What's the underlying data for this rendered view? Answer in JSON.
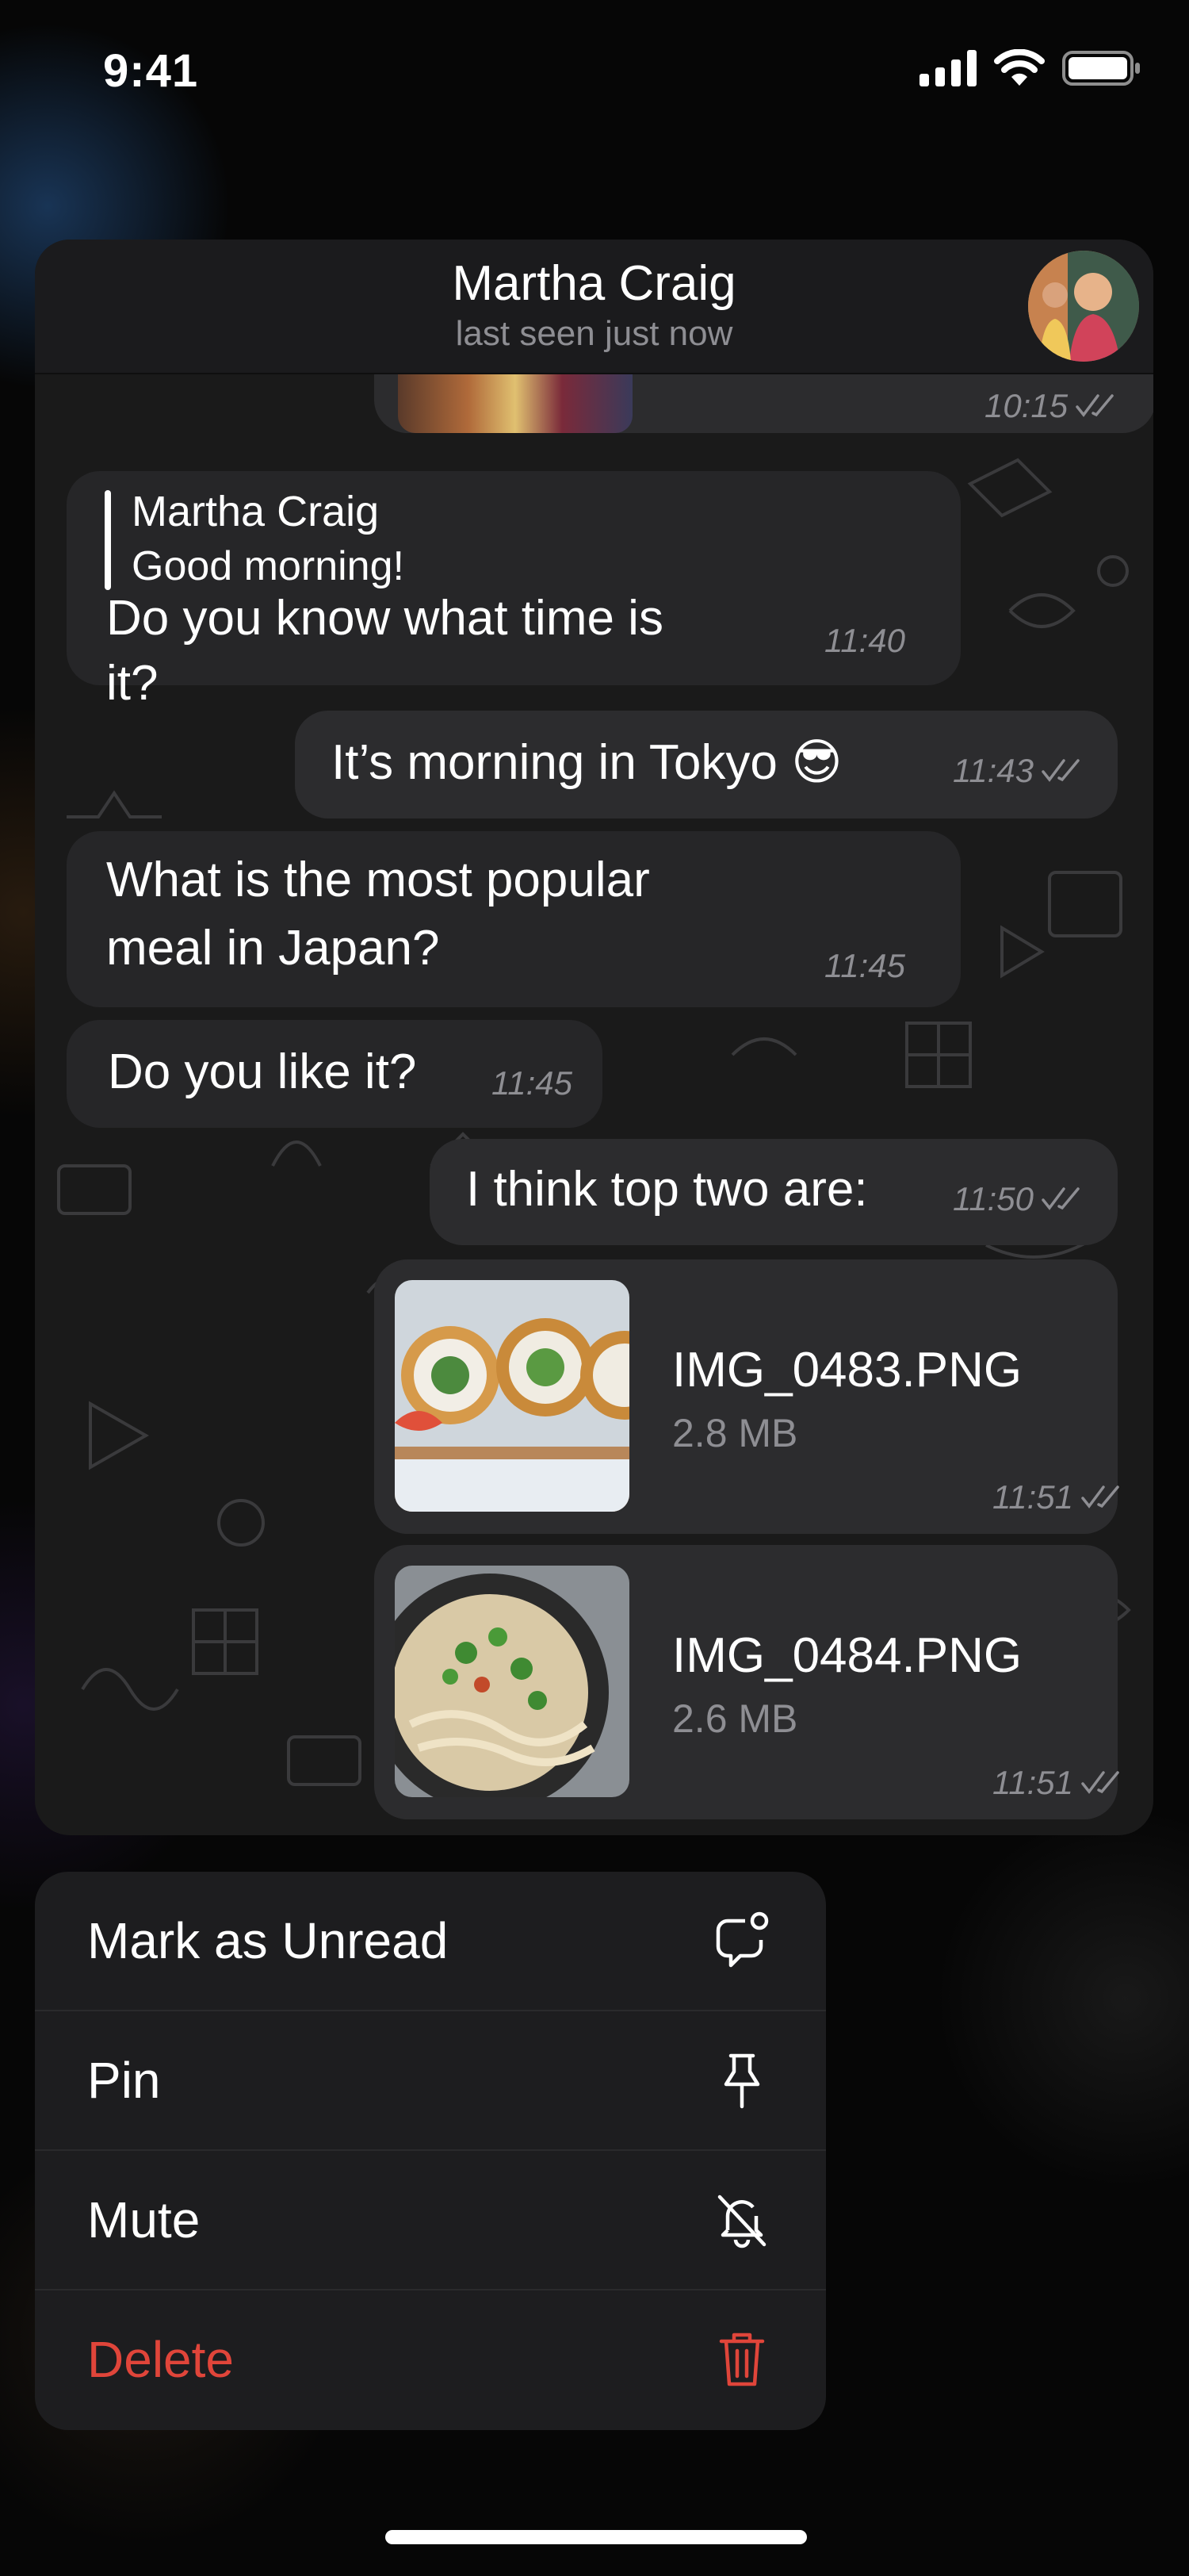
{
  "status_bar": {
    "time": "9:41"
  },
  "chat": {
    "contact_name": "Martha Craig",
    "subtitle": "last seen just now",
    "messages": [
      {
        "id": "m0",
        "direction": "out",
        "type": "image-partial",
        "time": "10:15"
      },
      {
        "id": "m1",
        "direction": "in",
        "reply_to_name": "Martha Craig",
        "reply_to_text": "Good morning!",
        "text_line1": "Do you know what time is",
        "text_line2": "it?",
        "time": "11:40"
      },
      {
        "id": "m2",
        "direction": "out",
        "text": "It’s morning in Tokyo 😎",
        "time": "11:43"
      },
      {
        "id": "m3",
        "direction": "in",
        "text_line1": "What is the most popular",
        "text_line2": "meal in Japan?",
        "time": "11:45"
      },
      {
        "id": "m4",
        "direction": "in",
        "text": "Do you like it?",
        "time": "11:45"
      },
      {
        "id": "m5",
        "direction": "out",
        "text": "I think top two are:",
        "time": "11:50"
      },
      {
        "id": "m6",
        "direction": "out",
        "type": "file",
        "file_name": "IMG_0483.PNG",
        "file_size": "2.8 MB",
        "time": "11:51"
      },
      {
        "id": "m7",
        "direction": "out",
        "type": "file",
        "file_name": "IMG_0484.PNG",
        "file_size": "2.6 MB",
        "time": "11:51"
      }
    ]
  },
  "menu": {
    "items": [
      {
        "label": "Mark as Unread",
        "icon": "unread-bubble-icon"
      },
      {
        "label": "Pin",
        "icon": "pin-icon"
      },
      {
        "label": "Mute",
        "icon": "bell-slash-icon"
      },
      {
        "label": "Delete",
        "icon": "trash-icon",
        "color": "#e0453a"
      }
    ]
  },
  "colors": {
    "background": "#050505",
    "bubble_incoming": "#262628",
    "bubble_outgoing": "#2c2c2e",
    "secondary_text": "#8e8e93",
    "danger": "#e0453a"
  }
}
